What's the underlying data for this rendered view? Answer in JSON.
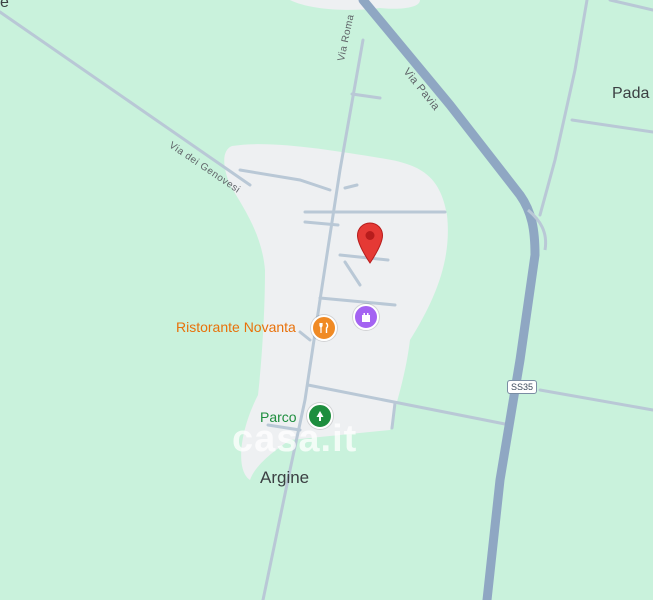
{
  "map": {
    "colors": {
      "land": "#c9f2dc",
      "settlement": "#eef0f2",
      "road_main": "#8fa7c3",
      "road_minor": "#b9c8d6",
      "marker": "#e53935",
      "food_poi": "#f08a24",
      "park_poi": "#1e8e3e",
      "landmark_poi": "#a463f2"
    },
    "labels": {
      "top_left_partial": "e",
      "padana_partial": "Pada",
      "via_roma": "Via Roma",
      "via_pavia": "Via Pavia",
      "via_genovesi": "Via dei Genovesi",
      "restaurant": "Ristorante Novanta",
      "park": "Parco",
      "town": "Argine",
      "road_shield": "SS35",
      "watermark": "casa.it"
    },
    "icons": {
      "restaurant": "fork-knife-icon",
      "park": "tree-icon",
      "landmark": "castle-icon",
      "marker": "location-pin-icon"
    }
  }
}
